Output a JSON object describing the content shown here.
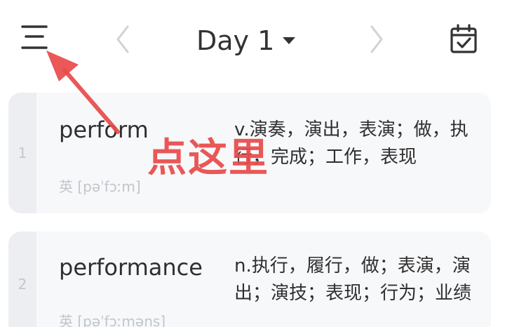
{
  "header": {
    "day_label": "Day 1",
    "icons": {
      "menu": "menu-icon",
      "prev": "chevron-left-icon",
      "next": "chevron-right-icon",
      "calendar": "calendar-check-icon"
    }
  },
  "words": [
    {
      "index": "1",
      "word": "perform",
      "phonetic": "英 [pəˈfɔːm]",
      "definition": "v.演奏，演出，表演；做，执行，完成；工作，表现"
    },
    {
      "index": "2",
      "word": "performance",
      "phonetic": "英 [pəˈfɔːməns]",
      "definition": "n.执行，履行，做；表演，演出；演技；表现；行为；业绩"
    }
  ],
  "annotation": {
    "text": "点这里",
    "color": "#e84a4a"
  },
  "colors": {
    "text_primary": "#2f2f2f",
    "text_muted": "#c2c5ca",
    "card_bg": "#f7f8fa",
    "strip_bg": "#eceef2"
  }
}
